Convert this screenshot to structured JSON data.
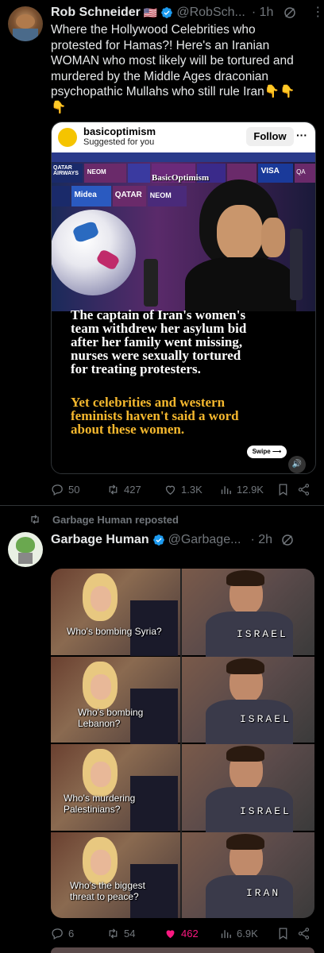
{
  "tweet1": {
    "author_name": "Rob Schneider",
    "flag": "🇺🇸",
    "handle": "@RobSch...",
    "time": "· 1h",
    "text_lines": [
      "Where the Hollywood Celebrities who",
      "protested for Hamas?! Here's an Iranian",
      "WOMAN who most likely will be  tortured and",
      "murdered by the Middle Ages draconian",
      "psychopathic Mullahs who still rule Iran👇👇",
      "👇"
    ],
    "embed": {
      "account": "basicoptimism",
      "sub": "Suggested for you",
      "follow_label": "Follow",
      "more": "···",
      "watermark": "BasicOptimism",
      "headline_lines": [
        "The captain of Iran's women's",
        "team withdrew her asylum bid",
        "after her family went missing,",
        "nurses were sexually tortured",
        "for treating protesters."
      ],
      "sub_lines": [
        "Yet celebrities and western",
        "feminists haven't said a word",
        "about these women."
      ],
      "swipe_label": "Swipe ⟶",
      "sponsor_boards": [
        "QATAR AIRWAYS",
        "NEOM",
        "Midea",
        "QATAR",
        "NEOM",
        "VISA",
        "Midea",
        "QA"
      ]
    },
    "actions": {
      "replies": "50",
      "reposts": "427",
      "likes": "1.3K",
      "views": "12.9K"
    }
  },
  "tweet2": {
    "repost_label": "Garbage Human reposted",
    "author_name": "Garbage Human",
    "handle": "@Garbage...",
    "time": "· 2h",
    "meme": {
      "questions": [
        "Who's bombing Syria?",
        "Who's bombing Lebanon?",
        "Who's murdering Palestinians?",
        "Who's the biggest threat  to peace?"
      ],
      "answers": [
        "ISRAEL",
        "ISRAEL",
        "ISRAEL",
        "IRAN"
      ]
    },
    "actions": {
      "replies": "6",
      "reposts": "54",
      "likes": "462",
      "views": "6.9K"
    }
  },
  "colors": {
    "like_active": "#f91880",
    "verified": "#1d9bf0",
    "embed_yellow": "#f5b82e"
  }
}
